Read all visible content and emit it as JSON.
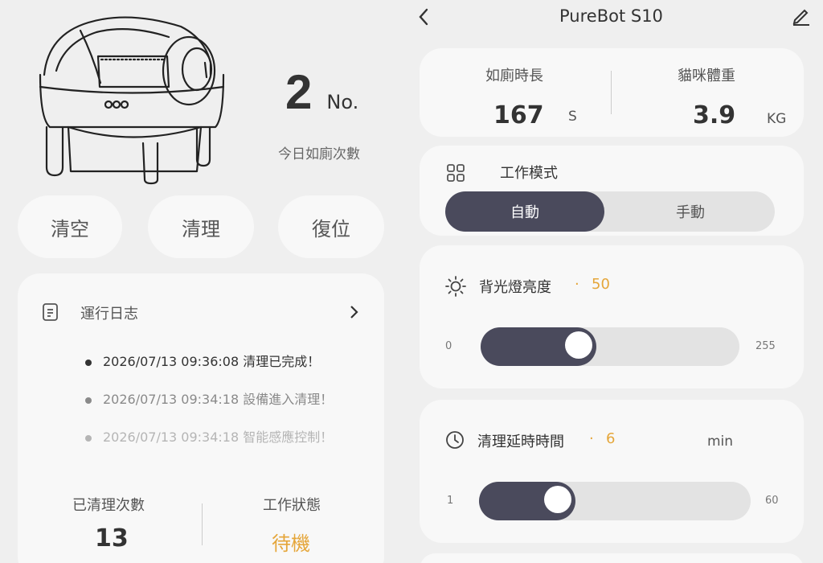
{
  "device": {
    "counter_value": "2",
    "counter_unit": "No.",
    "counter_label": "今日如廁次數"
  },
  "actions": {
    "empty": "清空",
    "clean": "清理",
    "reset": "復位"
  },
  "log": {
    "title": "運行日志",
    "entries": [
      {
        "text": "2026/07/13 09:36:08 清理已完成！",
        "color": "#333333"
      },
      {
        "text": "2026/07/13 09:34:18 設備進入清理！",
        "color": "#8a8a8a"
      },
      {
        "text": "2026/07/13 09:34:18 智能感應控制！",
        "color": "#b5b5b5"
      }
    ]
  },
  "stats": {
    "cleaned_label": "已清理次數",
    "cleaned_value": "13",
    "status_label": "工作狀態",
    "status_value": "待機"
  },
  "header": {
    "title": "PureBot S10"
  },
  "metrics": {
    "duration_label": "如廁時長",
    "duration_value": "167",
    "duration_unit": "S",
    "weight_label": "貓咪體重",
    "weight_value": "3.9",
    "weight_unit": "KG"
  },
  "mode": {
    "label": "工作模式",
    "auto": "自動",
    "manual": "手動",
    "selected": "自動"
  },
  "backlight": {
    "label": "背光燈亮度",
    "sep": "·",
    "value": "50",
    "min": "0",
    "max": "255",
    "level": 50
  },
  "delay": {
    "label": "清理延時時間",
    "sep": "·",
    "value": "6",
    "unit": "min",
    "min": "1",
    "max": "60",
    "level": 6
  },
  "colors": {
    "accent": "#e5a63a",
    "dark": "#4a4a5c",
    "bg": "#efefef",
    "card": "#f8f8f8"
  }
}
